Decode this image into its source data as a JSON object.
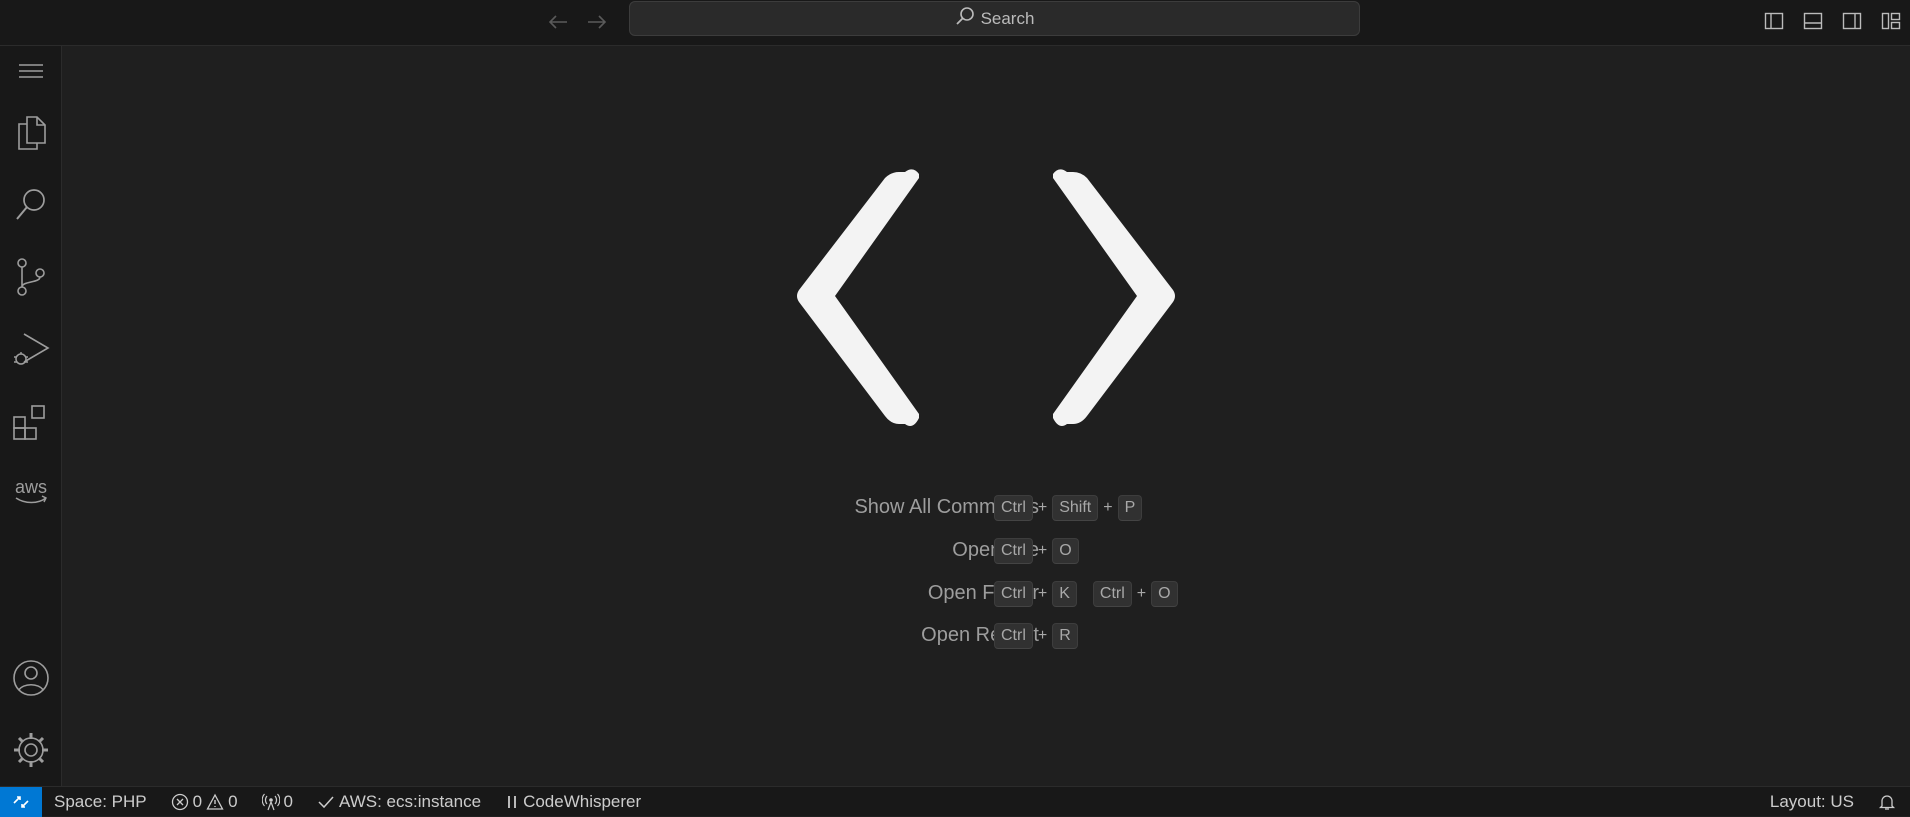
{
  "titlebar": {
    "search_placeholder": "Search",
    "icons": [
      "back-arrow-icon",
      "forward-arrow-icon",
      "search-icon",
      "toggle-primary-sidebar-icon",
      "toggle-panel-icon",
      "toggle-secondary-sidebar-icon",
      "customize-layout-icon"
    ]
  },
  "activitybar": {
    "items": [
      "menu-icon",
      "explorer-icon",
      "search-icon",
      "source-control-icon",
      "run-debug-icon",
      "extensions-icon",
      "aws-icon"
    ],
    "aws_label": "aws",
    "bottom_items": [
      "accounts-icon",
      "manage-gear-icon"
    ]
  },
  "welcome": {
    "commands": [
      {
        "label": "Show All Commands",
        "keys": [
          [
            "Ctrl",
            "Shift",
            "P"
          ]
        ]
      },
      {
        "label": "Open File",
        "keys": [
          [
            "Ctrl",
            "O"
          ]
        ]
      },
      {
        "label": "Open Folder",
        "keys": [
          [
            "Ctrl",
            "K"
          ],
          [
            "Ctrl",
            "O"
          ]
        ]
      },
      {
        "label": "Open Recent",
        "keys": [
          [
            "Ctrl",
            "R"
          ]
        ]
      }
    ],
    "plus": "+"
  },
  "statusbar": {
    "space": "Space: PHP",
    "errors": "0",
    "warnings": "0",
    "ports": "0",
    "aws": "AWS: ecs:instance",
    "codewhisperer": "CodeWhisperer",
    "layout": "Layout: US"
  },
  "colors": {
    "remote_accent": "#0078d4",
    "background": "#1f1f1f",
    "chrome": "#181818"
  }
}
